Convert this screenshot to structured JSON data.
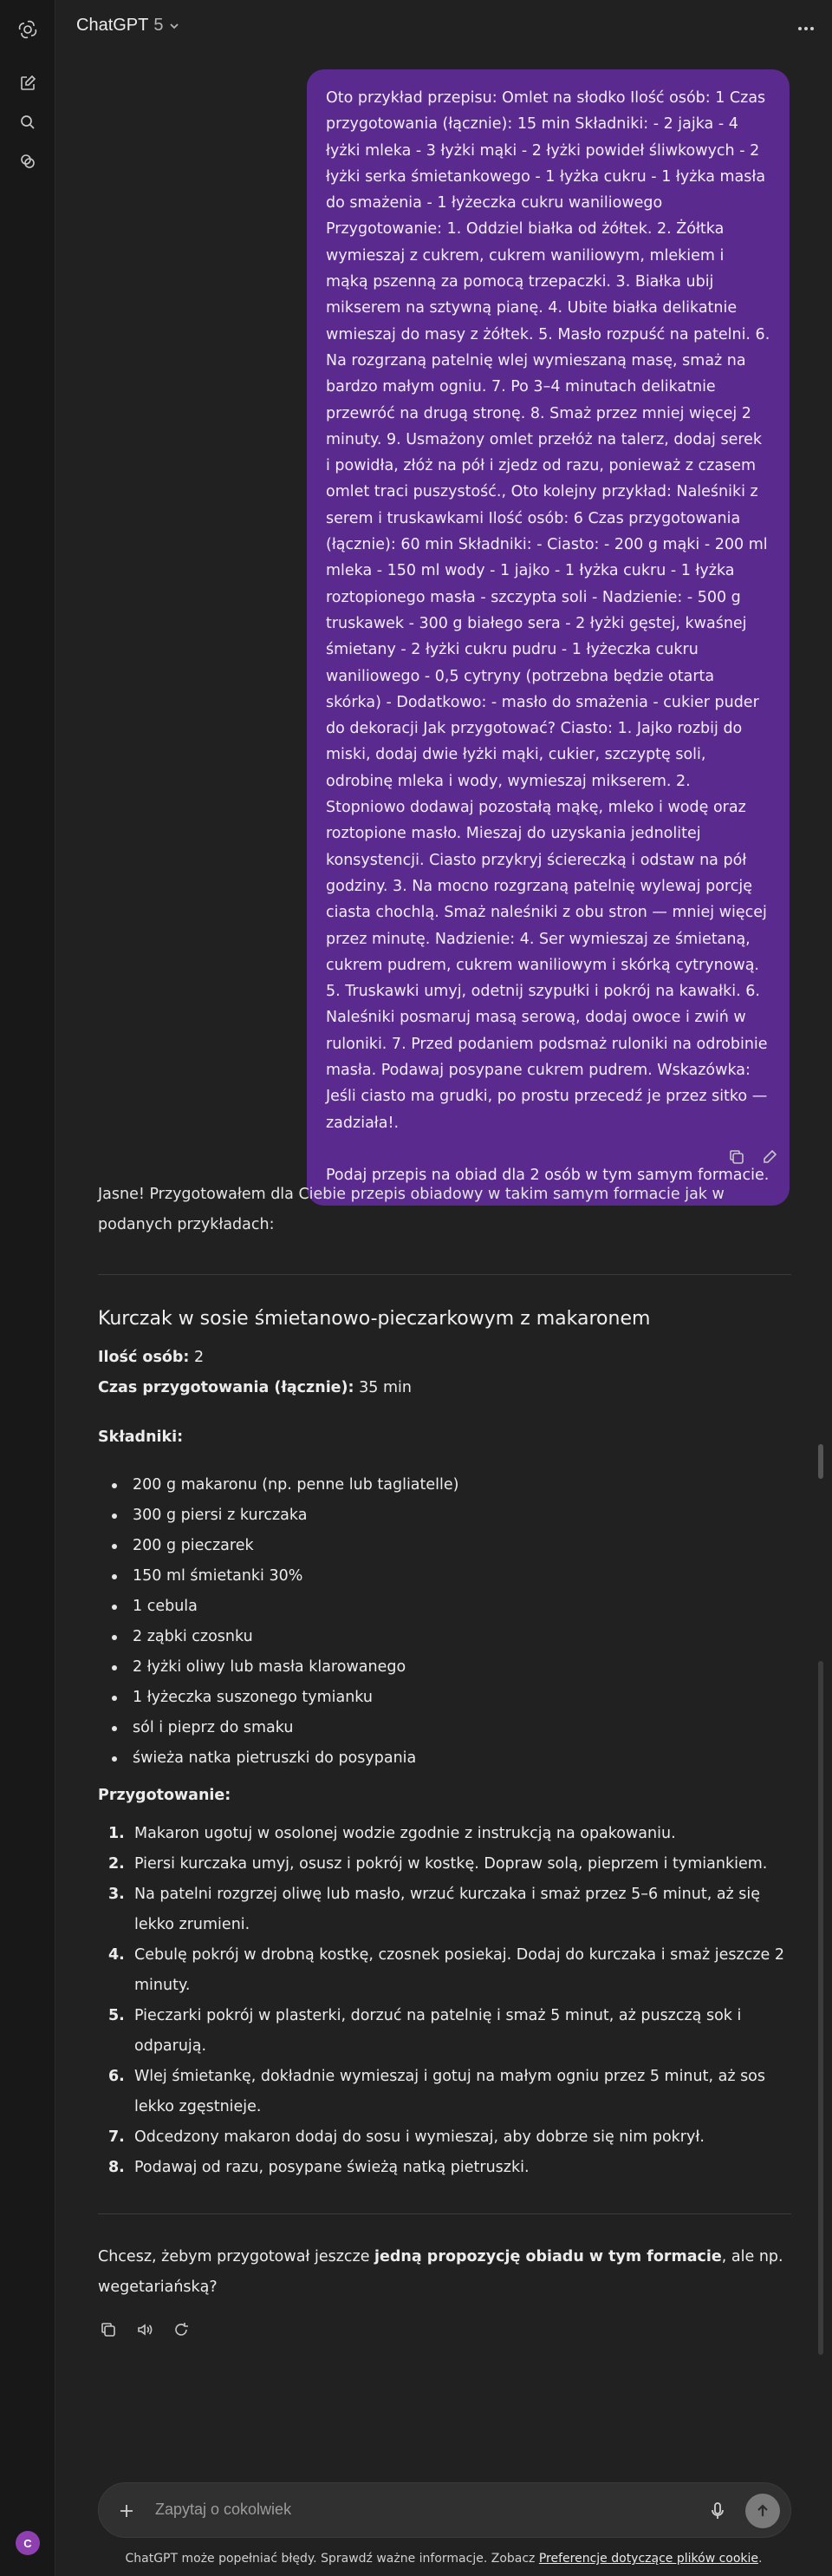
{
  "header": {
    "app_name": "ChatGPT",
    "model_version": "5"
  },
  "user_message": {
    "text": "Oto przykład przepisu: Omlet na słodko Ilość osób: 1 Czas przygotowania (łącznie): 15 min Składniki: - 2 jajka - 4 łyżki mleka - 3 łyżki mąki - 2 łyżki powideł śliwkowych - 2 łyżki serka śmietankowego - 1 łyżka cukru - 1 łyżka masła do smażenia - 1 łyżeczka cukru waniliowego Przygotowanie: 1. Oddziel białka od żółtek. 2. Żółtka wymieszaj z cukrem, cukrem waniliowym, mlekiem i mąką pszenną za pomocą trzepaczki. 3. Białka ubij mikserem na sztywną pianę. 4. Ubite białka delikatnie wmieszaj do masy z żółtek. 5. Masło rozpuść na patelni. 6. Na rozgrzaną patelnię wlej wymieszaną masę, smaż na bardzo małym ogniu. 7. Po 3–4 minutach delikatnie przewróć na drugą stronę. 8. Smaż przez mniej więcej 2 minuty. 9. Usmażony omlet przełóż na talerz, dodaj serek i powidła, złóż na pół i zjedz od razu, ponieważ z czasem omlet traci puszystość., Oto kolejny przykład: Naleśniki z serem i truskawkami Ilość osób: 6 Czas przygotowania (łącznie): 60 min Składniki: - Ciasto: - 200 g mąki - 200 ml mleka - 150 ml wody - 1 jajko - 1 łyżka cukru - 1 łyżka roztopionego masła - szczypta soli - Nadzienie: - 500 g truskawek - 300 g białego sera - 2 łyżki gęstej, kwaśnej śmietany - 2 łyżki cukru pudru - 1 łyżeczka cukru waniliowego - 0,5 cytryny (potrzebna będzie otarta skórka) - Dodatkowo: - masło do smażenia - cukier puder do dekoracji Jak przygotować? Ciasto: 1. Jajko rozbij do miski, dodaj dwie łyżki mąki, cukier, szczyptę soli, odrobinę mleka i wody, wymieszaj mikserem. 2. Stopniowo dodawaj pozostałą mąkę, mleko i wodę oraz roztopione masło. Mieszaj do uzyskania jednolitej konsystencji. Ciasto przykryj ściereczką i odstaw na pół godziny. 3. Na mocno rozgrzaną patelnię wylewaj porcję ciasta chochlą. Smaż naleśniki z obu stron — mniej więcej przez minutę. Nadzienie: 4. Ser wymieszaj ze śmietaną, cukrem pudrem, cukrem waniliowym i skórką cytrynową. 5. Truskawki umyj, odetnij szypułki i pokrój na kawałki. 6. Naleśniki posmaruj masą serową, dodaj owoce i zwiń w ruloniki. 7. Przed podaniem podsmaż ruloniki na odrobinie masła. Podawaj posypane cukrem pudrem. Wskazówka: Jeśli ciasto ma grudki, po prostu przecedź je przez sitko — zadziała!.",
    "request": "Podaj przepis na obiad dla 2 osób w tym samym formacie."
  },
  "assistant": {
    "intro": "Jasne! Przygotowałem dla Ciebie przepis obiadowy w takim samym formacie jak w podanych przykładach:",
    "recipe_title": "Kurczak w sosie śmietanowo-pieczarkowym z makaronem",
    "servings_label": "Ilość osób:",
    "servings_value": "2",
    "time_label": "Czas przygotowania (łącznie):",
    "time_value": "35 min",
    "ingredients_heading": "Składniki:",
    "ingredients": [
      "200 g makaronu (np. penne lub tagliatelle)",
      "300 g piersi z kurczaka",
      "200 g pieczarek",
      "150 ml śmietanki 30%",
      "1 cebula",
      "2 ząbki czosnku",
      "2 łyżki oliwy lub masła klarowanego",
      "1 łyżeczka suszonego tymianku",
      "sól i pieprz do smaku",
      "świeża natka pietruszki do posypania"
    ],
    "steps_heading": "Przygotowanie:",
    "steps": [
      {
        "num": "1.",
        "text": "Makaron ugotuj w osolonej wodzie zgodnie z instrukcją na opakowaniu."
      },
      {
        "num": "2.",
        "text": "Piersi kurczaka umyj, osusz i pokrój w kostkę. Dopraw solą, pieprzem i tymiankiem."
      },
      {
        "num": "3.",
        "text": "Na patelni rozgrzej oliwę lub masło, wrzuć kurczaka i smaż przez 5–6 minut, aż się lekko zrumieni."
      },
      {
        "num": "4.",
        "text": "Cebulę pokrój w drobną kostkę, czosnek posiekaj. Dodaj do kurczaka i smaż jeszcze 2 minuty."
      },
      {
        "num": "5.",
        "text": "Pieczarki pokrój w plasterki, dorzuć na patelnię i smaż 5 minut, aż puszczą sok i odparują."
      },
      {
        "num": "6.",
        "text": "Wlej śmietankę, dokładnie wymieszaj i gotuj na małym ogniu przez 5 minut, aż sos lekko zgęstnieje."
      },
      {
        "num": "7.",
        "text": "Odcedzony makaron dodaj do sosu i wymieszaj, aby dobrze się nim pokrył."
      },
      {
        "num": "8.",
        "text": "Podawaj od razu, posypane świeżą natką pietruszki."
      }
    ],
    "followup_pre": "Chcesz, żebym przygotował jeszcze ",
    "followup_bold": "jedną propozycję obiadu w tym formacie",
    "followup_post": ", ale np. wegetariańską?"
  },
  "composer": {
    "placeholder": "Zapytaj o cokolwiek"
  },
  "footer": {
    "text": "ChatGPT może popełniać błędy. Sprawdź ważne informacje. Zobacz ",
    "link": "Preferencje dotyczące plików cookie",
    "end": "."
  },
  "user": {
    "avatar_initial": "C"
  },
  "colors": {
    "background": "#212121",
    "sidebar": "#181818",
    "user_bubble": "#5a2a8f",
    "avatar": "#8e3fb0"
  }
}
